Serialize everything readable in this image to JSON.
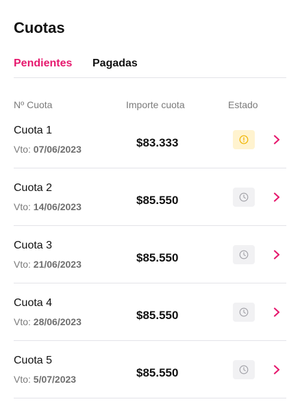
{
  "header": {
    "title": "Cuotas"
  },
  "tabs": [
    {
      "label": "Pendientes",
      "active": true
    },
    {
      "label": "Pagadas",
      "active": false
    }
  ],
  "columns": {
    "number": "Nº Cuota",
    "amount": "Importe cuota",
    "status": "Estado"
  },
  "due_prefix": "Vto: ",
  "installments": [
    {
      "title": "Cuota 1",
      "due_date": "07/06/2023",
      "amount": "$83.333",
      "status_icon": "alert-circle-icon"
    },
    {
      "title": "Cuota 2",
      "due_date": "14/06/2023",
      "amount": "$85.550",
      "status_icon": "clock-icon"
    },
    {
      "title": "Cuota 3",
      "due_date": "21/06/2023",
      "amount": "$85.550",
      "status_icon": "clock-icon"
    },
    {
      "title": "Cuota 4",
      "due_date": "28/06/2023",
      "amount": "$85.550",
      "status_icon": "clock-icon"
    },
    {
      "title": "Cuota 5",
      "due_date": "5/07/2023",
      "amount": "$85.550",
      "status_icon": "clock-icon"
    }
  ],
  "colors": {
    "accent": "#e6196e",
    "pending_bg": "#fff3cf",
    "pending_icon": "#f0b400",
    "scheduled_bg": "#f1f1f3",
    "scheduled_icon": "#a0a0a6"
  }
}
